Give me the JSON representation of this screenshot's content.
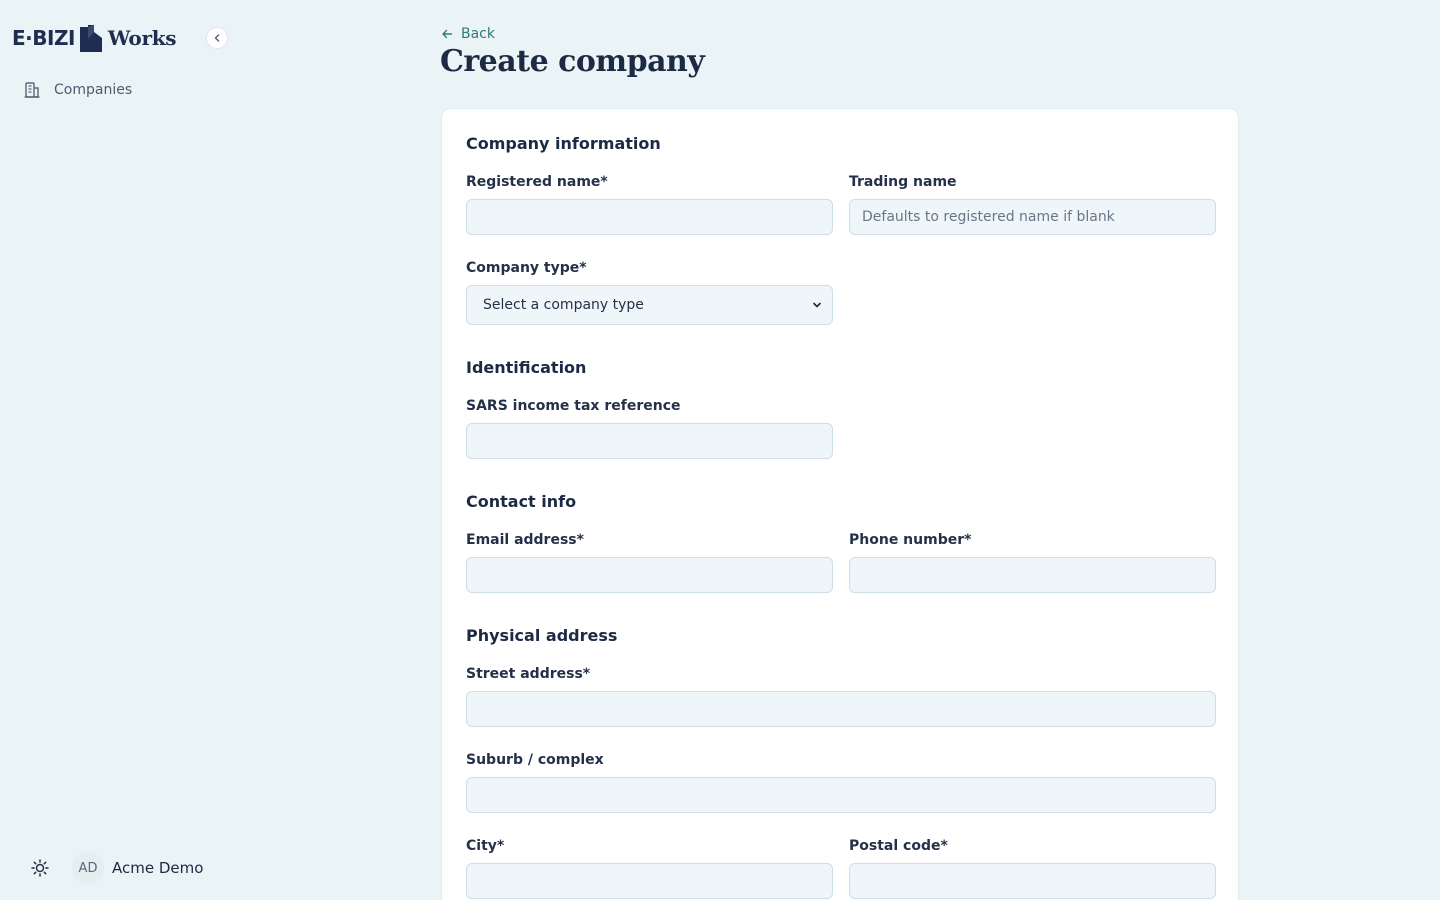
{
  "sidebar": {
    "logo_left": "E·BIZI",
    "logo_right": "Works",
    "nav": [
      {
        "label": "Companies",
        "icon": "building-icon"
      }
    ],
    "user": {
      "initials": "AD",
      "name": "Acme Demo"
    }
  },
  "header": {
    "back_label": "Back",
    "title": "Create company"
  },
  "form": {
    "sections": {
      "company_information": "Company information",
      "identification": "Identification",
      "contact_info": "Contact info",
      "physical_address": "Physical address"
    },
    "fields": {
      "registered_name": {
        "label": "Registered name*",
        "value": ""
      },
      "trading_name": {
        "label": "Trading name",
        "value": "",
        "placeholder": "Defaults to registered name if blank"
      },
      "company_type": {
        "label": "Company type*",
        "selected": "Select a company type"
      },
      "sars_ref": {
        "label": "SARS income tax reference",
        "value": ""
      },
      "email": {
        "label": "Email address*",
        "value": ""
      },
      "phone": {
        "label": "Phone number*",
        "value": ""
      },
      "street": {
        "label": "Street address*",
        "value": ""
      },
      "suburb": {
        "label": "Suburb / complex",
        "value": ""
      },
      "city": {
        "label": "City*",
        "value": ""
      },
      "postal_code": {
        "label": "Postal code*",
        "value": ""
      }
    }
  },
  "colors": {
    "background": "#eaf3f6",
    "accent": "#2f7c77",
    "text": "#1d2a44",
    "input_bg": "#eff6fa"
  }
}
